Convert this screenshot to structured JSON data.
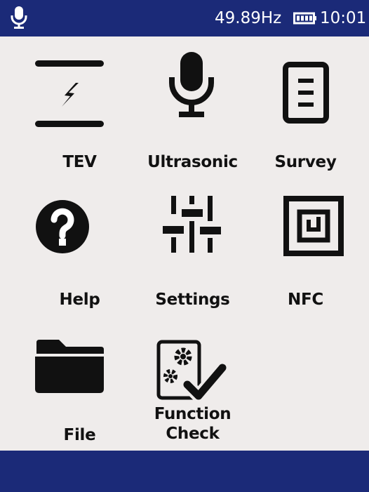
{
  "statusbar": {
    "mic_icon": "microphone-icon",
    "frequency": "49.89Hz",
    "battery_icon": "battery-icon",
    "time": "10:01"
  },
  "menu": {
    "tev": {
      "label": "TEV",
      "icon": "tev-icon"
    },
    "ultrasonic": {
      "label": "Ultrasonic",
      "icon": "microphone-icon"
    },
    "survey": {
      "label": "Survey",
      "icon": "document-icon"
    },
    "help": {
      "label": "Help",
      "icon": "question-icon"
    },
    "settings": {
      "label": "Settings",
      "icon": "sliders-icon"
    },
    "nfc": {
      "label": "NFC",
      "icon": "nfc-icon"
    },
    "file": {
      "label": "File",
      "icon": "folder-icon"
    },
    "function_check": {
      "label_line1": "Function",
      "label_line2": "Check",
      "icon": "gear-check-icon"
    }
  },
  "colors": {
    "bar": "#1b2a78",
    "background": "#efeceb",
    "icon": "#111111"
  }
}
